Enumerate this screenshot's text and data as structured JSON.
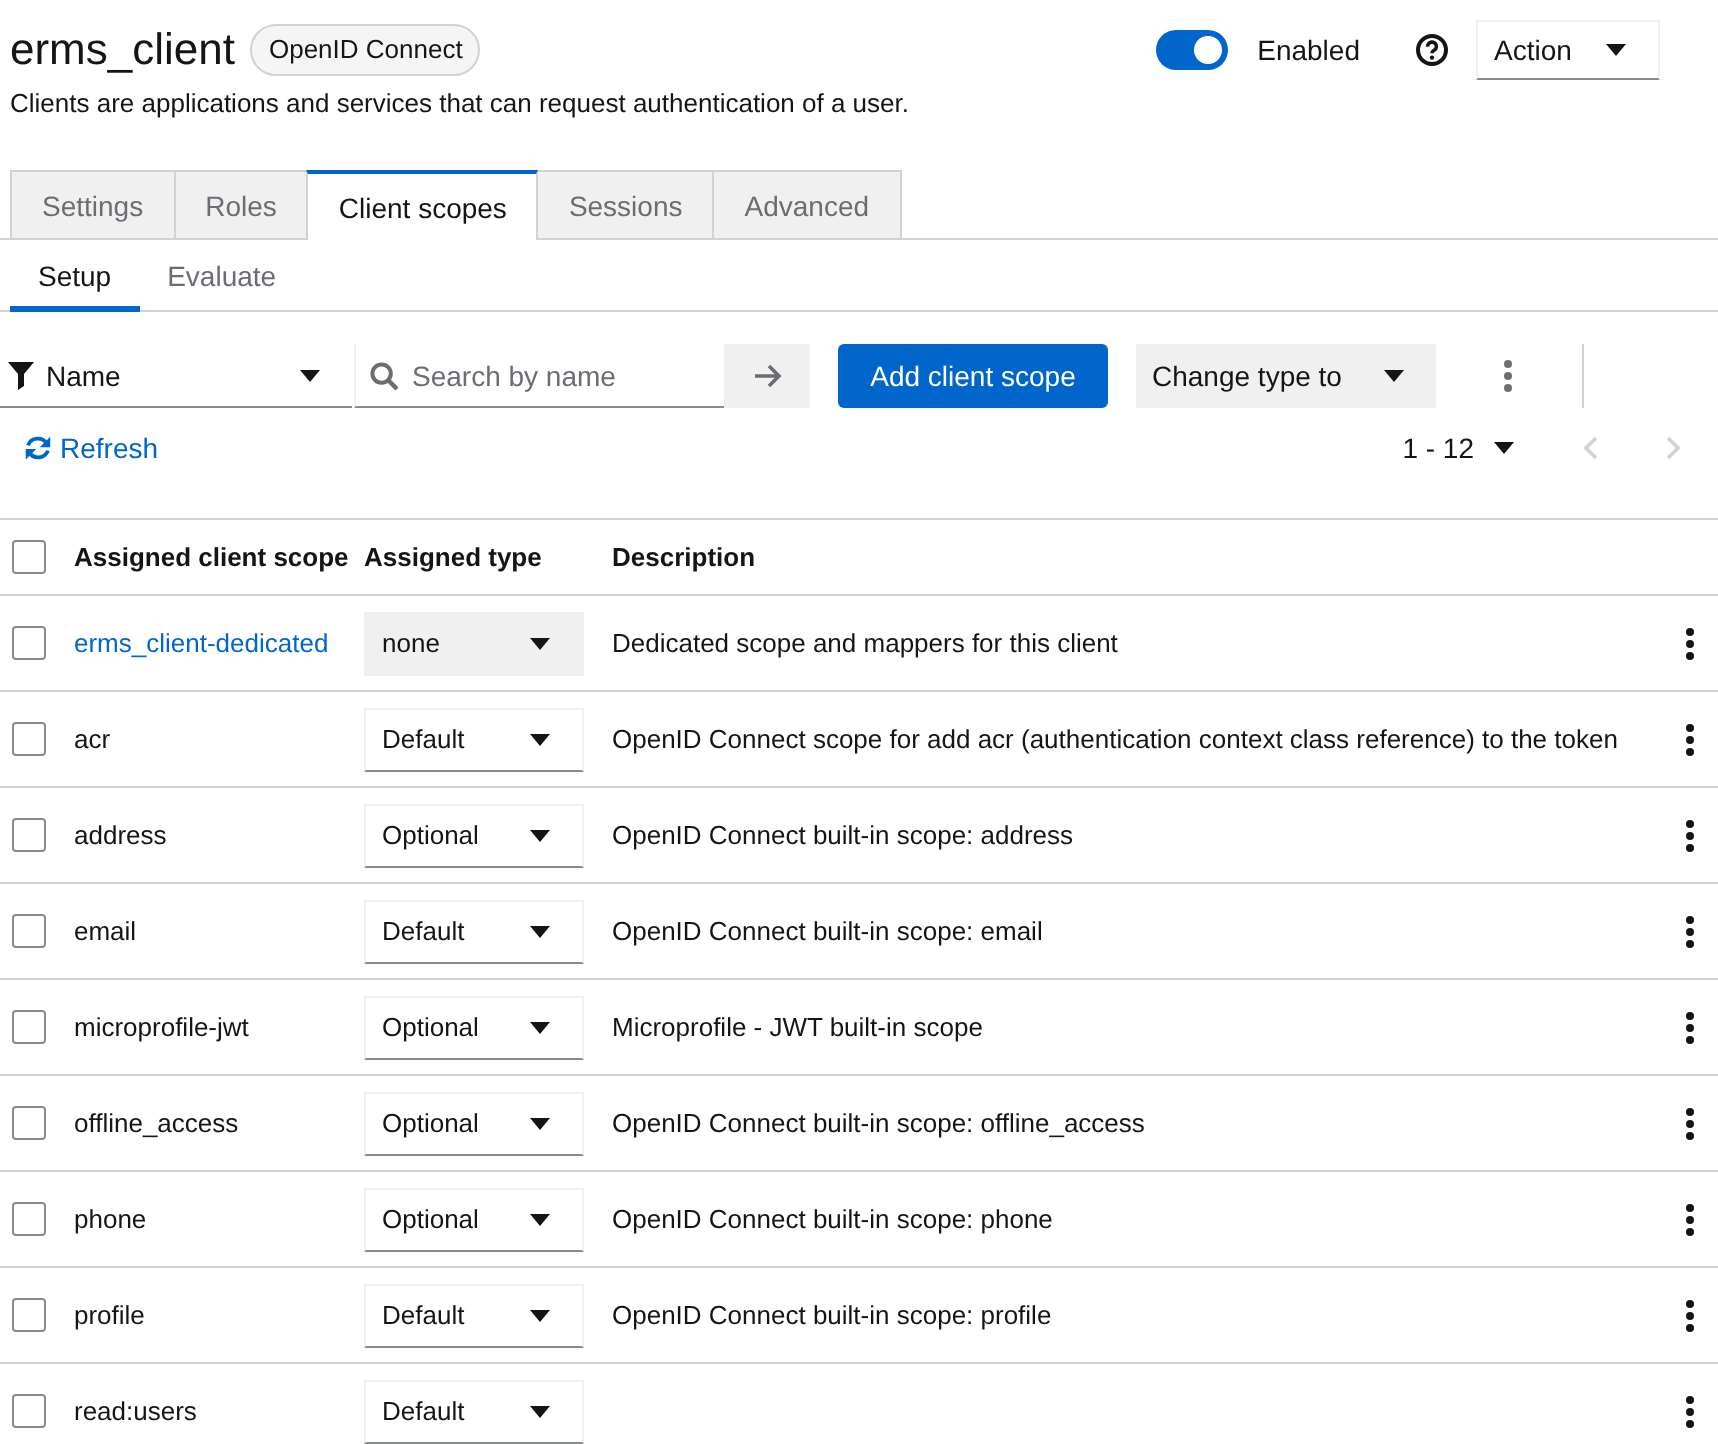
{
  "header": {
    "title": "erms_client",
    "badge": "OpenID Connect",
    "subtitle": "Clients are applications and services that can request authentication of a user.",
    "enabled_toggle": {
      "label": "Enabled",
      "on": true
    },
    "action_menu": {
      "label": "Action"
    }
  },
  "tabs": [
    {
      "label": "Settings",
      "selected": false
    },
    {
      "label": "Roles",
      "selected": false
    },
    {
      "label": "Client scopes",
      "selected": true
    },
    {
      "label": "Sessions",
      "selected": false
    },
    {
      "label": "Advanced",
      "selected": false
    }
  ],
  "subtabs": [
    {
      "label": "Setup",
      "selected": true
    },
    {
      "label": "Evaluate",
      "selected": false
    }
  ],
  "toolbar": {
    "filter": {
      "label": "Name"
    },
    "search": {
      "placeholder": "Search by name"
    },
    "add_button": "Add client scope",
    "change_type": {
      "label": "Change type to"
    }
  },
  "refresh": "Refresh",
  "pagination": {
    "range": "1 - 12",
    "prev": {
      "disabled": true
    },
    "next": {
      "disabled": true
    }
  },
  "table": {
    "select_all": {
      "checked": false
    },
    "columns": [
      "Assigned client scope",
      "Assigned type",
      "Description"
    ],
    "rows": [
      {
        "kind": "dedicated",
        "checked": false,
        "name": "erms_client-dedicated",
        "type": {
          "value": "none",
          "disabled": true
        },
        "description": "Dedicated scope and mappers for this client"
      },
      {
        "kind": "scope",
        "checked": false,
        "name": "acr",
        "type": {
          "value": "Default",
          "disabled": false
        },
        "description": "OpenID Connect scope for add acr (authentication context class reference) to the token"
      },
      {
        "kind": "scope",
        "checked": false,
        "name": "address",
        "type": {
          "value": "Optional",
          "disabled": false
        },
        "description": "OpenID Connect built-in scope: address"
      },
      {
        "kind": "scope",
        "checked": false,
        "name": "email",
        "type": {
          "value": "Default",
          "disabled": false
        },
        "description": "OpenID Connect built-in scope: email"
      },
      {
        "kind": "scope",
        "checked": false,
        "name": "microprofile-jwt",
        "type": {
          "value": "Optional",
          "disabled": false
        },
        "description": "Microprofile - JWT built-in scope"
      },
      {
        "kind": "scope",
        "checked": false,
        "name": "offline_access",
        "type": {
          "value": "Optional",
          "disabled": false
        },
        "description": "OpenID Connect built-in scope: offline_access"
      },
      {
        "kind": "scope",
        "checked": false,
        "name": "phone",
        "type": {
          "value": "Optional",
          "disabled": false
        },
        "description": "OpenID Connect built-in scope: phone"
      },
      {
        "kind": "scope",
        "checked": false,
        "name": "profile",
        "type": {
          "value": "Default",
          "disabled": false
        },
        "description": "OpenID Connect built-in scope: profile"
      },
      {
        "kind": "scope",
        "checked": false,
        "name": "read:users",
        "type": {
          "value": "Default",
          "disabled": false
        }
      }
    ]
  }
}
